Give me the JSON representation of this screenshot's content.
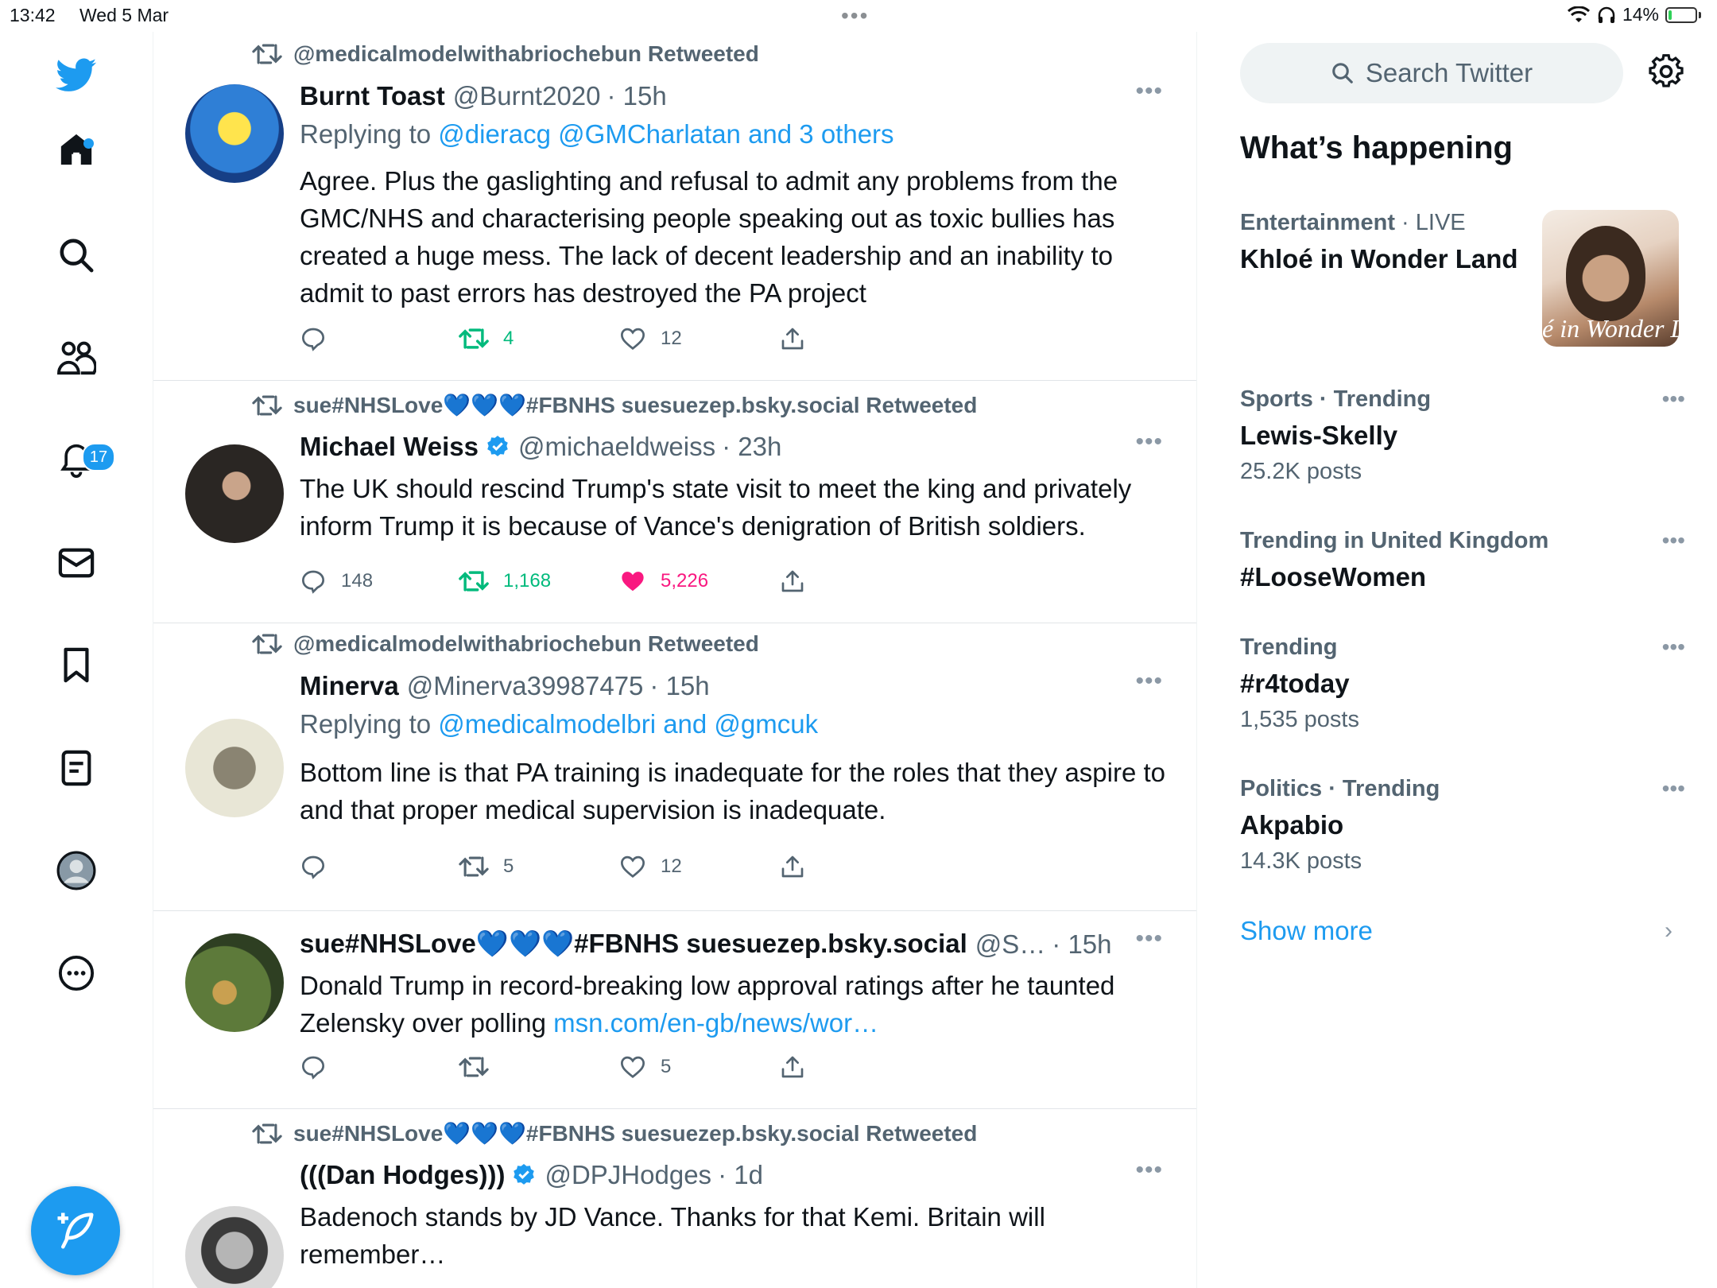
{
  "status_bar": {
    "time": "13:42",
    "date": "Wed 5 Mar",
    "battery": "14%",
    "battery_level": 0.14
  },
  "nav": {
    "notifications_count": "17"
  },
  "tweets": [
    {
      "retweeted_by": "@medicalmodelwithabriochebun Retweeted",
      "name": "Burnt Toast",
      "handle": "@Burnt2020",
      "time": "· 15h",
      "reply_prefix": "Replying to ",
      "reply_to": "@dieracg @GMCharlatan and 3 others",
      "text": "Agree. Plus the gaslighting and refusal to admit any problems from the GMC/NHS and characterising people speaking out as toxic bullies has created a huge mess. The lack of decent leadership and an inability to admit to past errors has destroyed the PA project",
      "retweets": "4",
      "likes": "12"
    },
    {
      "retweeted_by": "sue#NHSLove💙💙💙#FBNHS suesuezep.bsky.social Retweeted",
      "name": "Michael Weiss",
      "handle": "@michaeldweiss",
      "time": "· 23h",
      "text": "The UK should rescind Trump's state visit to meet the king and privately inform Trump it is because of Vance's denigration of British soldiers.",
      "replies": "148",
      "retweets": "1,168",
      "likes": "5,226"
    },
    {
      "retweeted_by": "@medicalmodelwithabriochebun Retweeted",
      "name": "Minerva",
      "handle": "@Minerva39987475",
      "time": "· 15h",
      "reply_prefix": "Replying to ",
      "reply_to": "@medicalmodelbri and @gmcuk",
      "text": "Bottom line is that PA training is inadequate for the roles that they aspire to and that proper medical supervision is inadequate.",
      "retweets": "5",
      "likes": "12"
    },
    {
      "name": "sue#NHSLove💙💙💙#FBNHS suesuezep.bsky.social",
      "handle": "@S…",
      "time": "· 15h",
      "text": "Donald Trump in record-breaking low approval ratings after he taunted Zelensky over polling ",
      "link": "msn.com/en-gb/news/wor…",
      "likes": "5"
    },
    {
      "retweeted_by": "sue#NHSLove💙💙💙#FBNHS suesuezep.bsky.social Retweeted",
      "name": "(((Dan Hodges)))",
      "handle": "@DPJHodges",
      "time": "· 1d",
      "text": "Badenoch stands by JD Vance. Thanks for that Kemi. Britain will remember…"
    }
  ],
  "sidebar": {
    "search_placeholder": "Search Twitter",
    "heading": "What’s happening",
    "trends": [
      {
        "category": "Entertainment",
        "suffix": " · LIVE",
        "title": "Khloé in Wonder Land",
        "image_text": "é in Wonder L"
      },
      {
        "category": "Sports · Trending",
        "title": "Lewis-Skelly",
        "count": "25.2K posts"
      },
      {
        "category": "Trending in United Kingdom",
        "title": "#LooseWomen"
      },
      {
        "category": "Trending",
        "title": "#r4today",
        "count": "1,535 posts"
      },
      {
        "category": "Politics · Trending",
        "title": "Akpabio",
        "count": "14.3K posts"
      }
    ],
    "show_more": "Show more"
  },
  "colors": {
    "accent": "#1d9bf0",
    "retweet_green": "#00ba7c",
    "like_pink": "#f91880",
    "muted": "#536471"
  }
}
